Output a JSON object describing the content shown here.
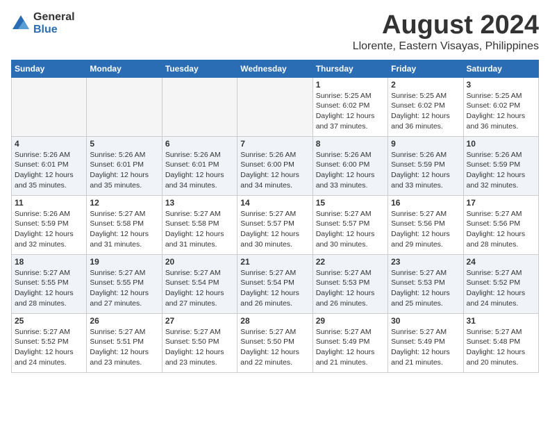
{
  "logo": {
    "general": "General",
    "blue": "Blue"
  },
  "title": "August 2024",
  "subtitle": "Llorente, Eastern Visayas, Philippines",
  "days_header": [
    "Sunday",
    "Monday",
    "Tuesday",
    "Wednesday",
    "Thursday",
    "Friday",
    "Saturday"
  ],
  "weeks": [
    [
      {
        "day": "",
        "info": ""
      },
      {
        "day": "",
        "info": ""
      },
      {
        "day": "",
        "info": ""
      },
      {
        "day": "",
        "info": ""
      },
      {
        "day": "1",
        "info": "Sunrise: 5:25 AM\nSunset: 6:02 PM\nDaylight: 12 hours\nand 37 minutes."
      },
      {
        "day": "2",
        "info": "Sunrise: 5:25 AM\nSunset: 6:02 PM\nDaylight: 12 hours\nand 36 minutes."
      },
      {
        "day": "3",
        "info": "Sunrise: 5:25 AM\nSunset: 6:02 PM\nDaylight: 12 hours\nand 36 minutes."
      }
    ],
    [
      {
        "day": "4",
        "info": "Sunrise: 5:26 AM\nSunset: 6:01 PM\nDaylight: 12 hours\nand 35 minutes."
      },
      {
        "day": "5",
        "info": "Sunrise: 5:26 AM\nSunset: 6:01 PM\nDaylight: 12 hours\nand 35 minutes."
      },
      {
        "day": "6",
        "info": "Sunrise: 5:26 AM\nSunset: 6:01 PM\nDaylight: 12 hours\nand 34 minutes."
      },
      {
        "day": "7",
        "info": "Sunrise: 5:26 AM\nSunset: 6:00 PM\nDaylight: 12 hours\nand 34 minutes."
      },
      {
        "day": "8",
        "info": "Sunrise: 5:26 AM\nSunset: 6:00 PM\nDaylight: 12 hours\nand 33 minutes."
      },
      {
        "day": "9",
        "info": "Sunrise: 5:26 AM\nSunset: 5:59 PM\nDaylight: 12 hours\nand 33 minutes."
      },
      {
        "day": "10",
        "info": "Sunrise: 5:26 AM\nSunset: 5:59 PM\nDaylight: 12 hours\nand 32 minutes."
      }
    ],
    [
      {
        "day": "11",
        "info": "Sunrise: 5:26 AM\nSunset: 5:59 PM\nDaylight: 12 hours\nand 32 minutes."
      },
      {
        "day": "12",
        "info": "Sunrise: 5:27 AM\nSunset: 5:58 PM\nDaylight: 12 hours\nand 31 minutes."
      },
      {
        "day": "13",
        "info": "Sunrise: 5:27 AM\nSunset: 5:58 PM\nDaylight: 12 hours\nand 31 minutes."
      },
      {
        "day": "14",
        "info": "Sunrise: 5:27 AM\nSunset: 5:57 PM\nDaylight: 12 hours\nand 30 minutes."
      },
      {
        "day": "15",
        "info": "Sunrise: 5:27 AM\nSunset: 5:57 PM\nDaylight: 12 hours\nand 30 minutes."
      },
      {
        "day": "16",
        "info": "Sunrise: 5:27 AM\nSunset: 5:56 PM\nDaylight: 12 hours\nand 29 minutes."
      },
      {
        "day": "17",
        "info": "Sunrise: 5:27 AM\nSunset: 5:56 PM\nDaylight: 12 hours\nand 28 minutes."
      }
    ],
    [
      {
        "day": "18",
        "info": "Sunrise: 5:27 AM\nSunset: 5:55 PM\nDaylight: 12 hours\nand 28 minutes."
      },
      {
        "day": "19",
        "info": "Sunrise: 5:27 AM\nSunset: 5:55 PM\nDaylight: 12 hours\nand 27 minutes."
      },
      {
        "day": "20",
        "info": "Sunrise: 5:27 AM\nSunset: 5:54 PM\nDaylight: 12 hours\nand 27 minutes."
      },
      {
        "day": "21",
        "info": "Sunrise: 5:27 AM\nSunset: 5:54 PM\nDaylight: 12 hours\nand 26 minutes."
      },
      {
        "day": "22",
        "info": "Sunrise: 5:27 AM\nSunset: 5:53 PM\nDaylight: 12 hours\nand 26 minutes."
      },
      {
        "day": "23",
        "info": "Sunrise: 5:27 AM\nSunset: 5:53 PM\nDaylight: 12 hours\nand 25 minutes."
      },
      {
        "day": "24",
        "info": "Sunrise: 5:27 AM\nSunset: 5:52 PM\nDaylight: 12 hours\nand 24 minutes."
      }
    ],
    [
      {
        "day": "25",
        "info": "Sunrise: 5:27 AM\nSunset: 5:52 PM\nDaylight: 12 hours\nand 24 minutes."
      },
      {
        "day": "26",
        "info": "Sunrise: 5:27 AM\nSunset: 5:51 PM\nDaylight: 12 hours\nand 23 minutes."
      },
      {
        "day": "27",
        "info": "Sunrise: 5:27 AM\nSunset: 5:50 PM\nDaylight: 12 hours\nand 23 minutes."
      },
      {
        "day": "28",
        "info": "Sunrise: 5:27 AM\nSunset: 5:50 PM\nDaylight: 12 hours\nand 22 minutes."
      },
      {
        "day": "29",
        "info": "Sunrise: 5:27 AM\nSunset: 5:49 PM\nDaylight: 12 hours\nand 21 minutes."
      },
      {
        "day": "30",
        "info": "Sunrise: 5:27 AM\nSunset: 5:49 PM\nDaylight: 12 hours\nand 21 minutes."
      },
      {
        "day": "31",
        "info": "Sunrise: 5:27 AM\nSunset: 5:48 PM\nDaylight: 12 hours\nand 20 minutes."
      }
    ]
  ]
}
